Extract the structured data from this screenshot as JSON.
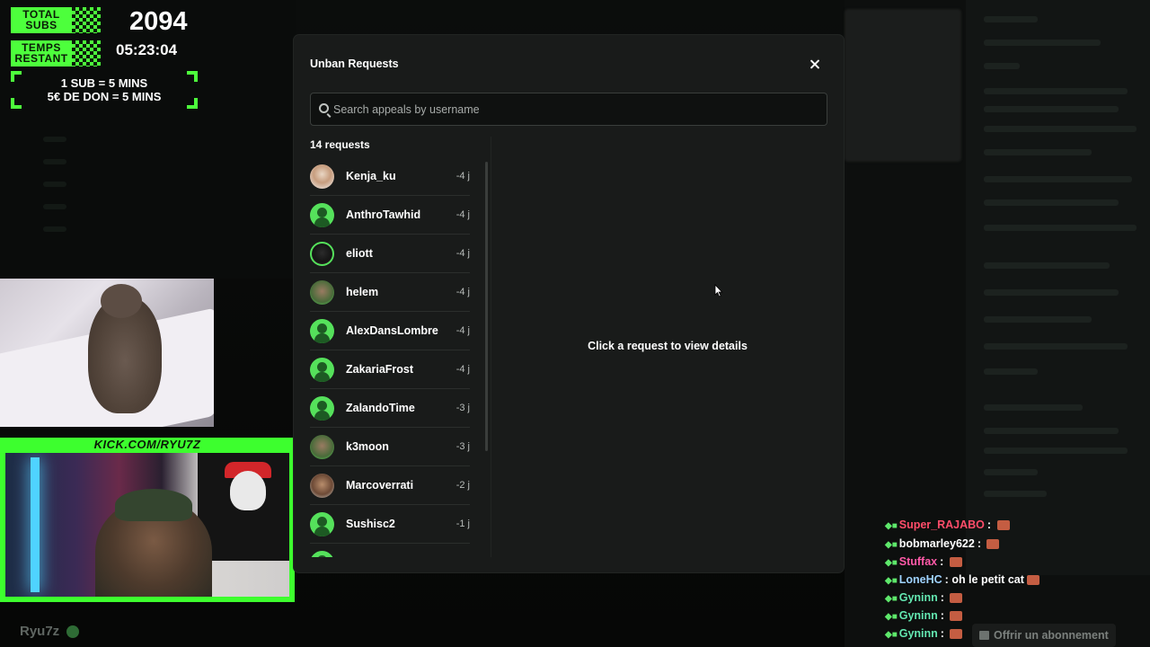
{
  "overlay": {
    "total_subs_label_1": "TOTAL",
    "total_subs_label_2": "SUBS",
    "time_label_1": "TEMPS",
    "time_label_2": "RESTANT",
    "sub_count": "2094",
    "time_left": "05:23:04",
    "rule_1": "1 SUB = 5 MINS",
    "rule_2": "5€ DE DON = 5 MINS",
    "accent_color": "#4dff3c"
  },
  "stream": {
    "kick_url": "KICK.COM/RYU7Z",
    "streamer_name": "Ryu7z",
    "sub_offer": "Offrir un abonnement"
  },
  "chat": [
    {
      "name": "Super_RAJABO",
      "text": "",
      "color": "#ff4d6a"
    },
    {
      "name": "bobmarley622",
      "text": "",
      "color": "#ffffff"
    },
    {
      "name": "Stuffax",
      "text": "",
      "color": "#ff5aa8"
    },
    {
      "name": "LoneHC",
      "text": "oh le petit cat",
      "color": "#9fd3ff"
    },
    {
      "name": "Gyninn",
      "text": "",
      "color": "#63e6b0"
    },
    {
      "name": "Gyninn",
      "text": "",
      "color": "#63e6b0"
    },
    {
      "name": "Gyninn",
      "text": "",
      "color": "#63e6b0"
    }
  ],
  "modal": {
    "title": "Unban Requests",
    "search_placeholder": "Search appeals by username",
    "requests_count": "14 requests",
    "detail_placeholder": "Click a request to view details",
    "requests": [
      {
        "name": "Kenja_ku",
        "age": "-4 j",
        "avatar": "photo-light"
      },
      {
        "name": "AnthroTawhid",
        "age": "-4 j",
        "avatar": "default"
      },
      {
        "name": "eliott",
        "age": "-4 j",
        "avatar": "photo-dark"
      },
      {
        "name": "helem",
        "age": "-4 j",
        "avatar": "photo-green"
      },
      {
        "name": "AlexDansLombre",
        "age": "-4 j",
        "avatar": "default"
      },
      {
        "name": "ZakariaFrost",
        "age": "-4 j",
        "avatar": "default"
      },
      {
        "name": "ZalandoTime",
        "age": "-3 j",
        "avatar": "default"
      },
      {
        "name": "k3moon",
        "age": "-3 j",
        "avatar": "photo-green"
      },
      {
        "name": "Marcoverrati",
        "age": "-2 j",
        "avatar": "photo-beard"
      },
      {
        "name": "Sushisc2",
        "age": "-1 j",
        "avatar": "default"
      },
      {
        "name": "",
        "age": "",
        "avatar": "default"
      }
    ]
  }
}
